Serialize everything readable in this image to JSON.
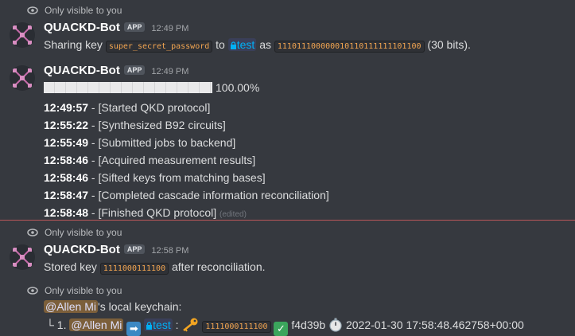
{
  "messages": [
    {
      "ephemeral": "Only visible to you",
      "author": "QUACKD-Bot",
      "badge": "APP",
      "time": "12:49 PM",
      "line": {
        "t1": "Sharing key",
        "code1": "super_secret_password",
        "t2": "to",
        "channel": "test",
        "t3": "as",
        "code2": "111011100000010110111111101100",
        "t4": "(30 bits)."
      }
    },
    {
      "author": "QUACKD-Bot",
      "badge": "APP",
      "time": "12:49 PM",
      "progress": {
        "value": 1.0,
        "label": "100.00%"
      },
      "log": [
        {
          "time": "12:49:57",
          "text": " - [Started QKD protocol]"
        },
        {
          "time": "12:55:22",
          "text": " - [Synthesized B92 circuits]"
        },
        {
          "time": "12:55:49",
          "text": " - [Submitted jobs to backend]"
        },
        {
          "time": "12:58:46",
          "text": " - [Acquired measurement results]"
        },
        {
          "time": "12:58:46",
          "text": " - [Sifted keys from matching bases]"
        },
        {
          "time": "12:58:47",
          "text": " - [Completed cascade information reconciliation]"
        },
        {
          "time": "12:58:48",
          "text": " - [Finished QKD protocol]"
        }
      ],
      "edited": "(edited)"
    },
    {
      "ephemeral": "Only visible to you",
      "author": "QUACKD-Bot",
      "badge": "APP",
      "time": "12:58 PM",
      "line": {
        "t1": "Stored key",
        "code": "1111000111100",
        "t2": "after reconciliation."
      }
    },
    {
      "ephemeral": "Only visible to you",
      "keychain": {
        "mention": "@Allen Mi",
        "title_rest": "'s local keychain:",
        "prefix": "└ 1.",
        "mention2": "@Allen Mi",
        "channel": "test",
        "colon": ":",
        "code": "1111000111100",
        "hash": "f4d39b",
        "timestamp": "2022-01-30 17:58:48.462758+00:00"
      }
    }
  ],
  "icons": [
    "eye-icon",
    "lock-icon",
    "arrow-right-icon",
    "key-icon",
    "check-mark-icon",
    "stopwatch-icon"
  ]
}
